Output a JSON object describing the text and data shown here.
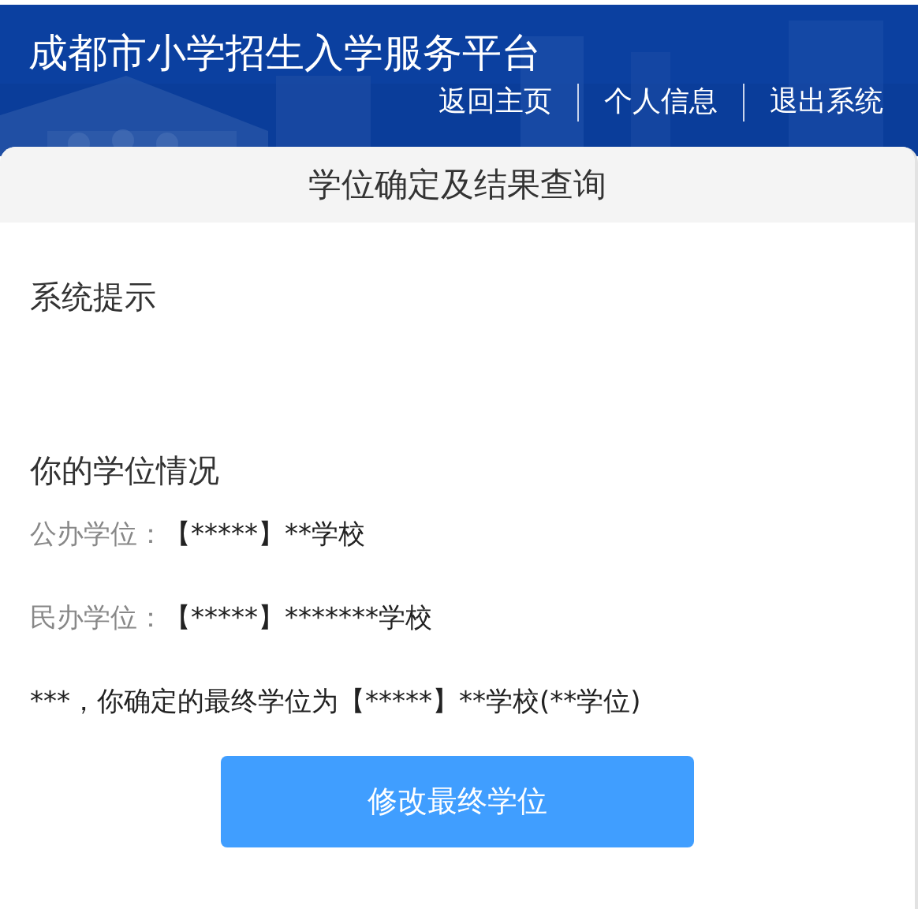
{
  "header": {
    "title": "成都市小学招生入学服务平台",
    "nav": [
      "返回主页",
      "个人信息",
      "退出系统"
    ]
  },
  "card": {
    "title": "学位确定及结果查询",
    "notice_heading": "系统提示",
    "status_heading": "你的学位情况",
    "seats": [
      {
        "label": "公办学位：",
        "value": "【*****】**学校"
      },
      {
        "label": "民办学位：",
        "value": "【*****】*******学校"
      }
    ],
    "final_note": "***，你确定的最终学位为【*****】**学校(**学位)",
    "button": "修改最终学位"
  }
}
